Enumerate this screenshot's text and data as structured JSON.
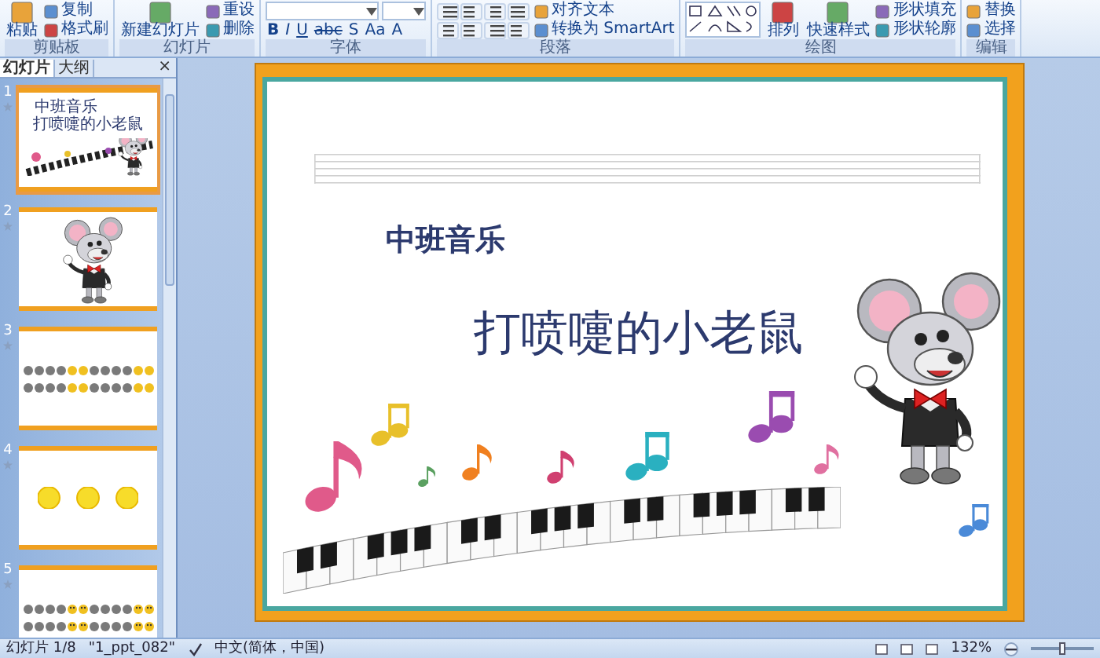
{
  "ribbon": {
    "groups": [
      {
        "label": "剪贴板",
        "kind": "plain",
        "big_buttons": [
          {
            "label": "粘贴"
          }
        ],
        "small_buttons": [
          {
            "label": "复制"
          },
          {
            "label": "格式刷"
          }
        ]
      },
      {
        "label": "幻灯片",
        "kind": "plain",
        "big_buttons": [
          {
            "label": "新建幻灯片"
          }
        ],
        "small_buttons": [
          {
            "label": "重设"
          },
          {
            "label": "删除"
          }
        ]
      },
      {
        "label": "字体",
        "kind": "font",
        "format_buttons": [
          "B",
          "I",
          "U",
          "abc",
          "S",
          "Aa",
          "A"
        ]
      },
      {
        "label": "段落",
        "kind": "paragraph",
        "small_buttons": [
          {
            "label": "对齐文本"
          },
          {
            "label": "转换为 SmartArt"
          }
        ]
      },
      {
        "label": "绘图",
        "kind": "drawing",
        "big_buttons": [
          {
            "label": "排列"
          },
          {
            "label": "快速样式"
          }
        ],
        "small_buttons": [
          {
            "label": "形状填充"
          },
          {
            "label": "形状轮廓"
          }
        ]
      },
      {
        "label": "编辑",
        "kind": "plain",
        "small_buttons": [
          {
            "label": "替换"
          },
          {
            "label": "选择"
          }
        ]
      }
    ]
  },
  "panel": {
    "tabs": [
      {
        "label": "幻灯片",
        "selected": true
      },
      {
        "label": "大纲",
        "selected": false
      }
    ],
    "close": "×"
  },
  "thumbnails": [
    {
      "number": "1",
      "kind": "title",
      "selected": true,
      "title": "中班音乐",
      "subtitle": "打喷嚏的小老鼠"
    },
    {
      "number": "2",
      "kind": "mouse",
      "selected": false
    },
    {
      "number": "3",
      "kind": "icon-rows",
      "selected": false
    },
    {
      "number": "4",
      "kind": "suns",
      "selected": false
    },
    {
      "number": "5",
      "kind": "faces",
      "selected": false
    }
  ],
  "slide": {
    "title": "中班音乐",
    "subtitle": "打喷嚏的小老鼠"
  },
  "status_bar": {
    "slide": "幻灯片 1/8",
    "theme": "\"1_ppt_082\"",
    "language": "中文(简体，中国)",
    "zoom": "132%",
    "zoom_slider": {
      "level": 0.5
    }
  }
}
